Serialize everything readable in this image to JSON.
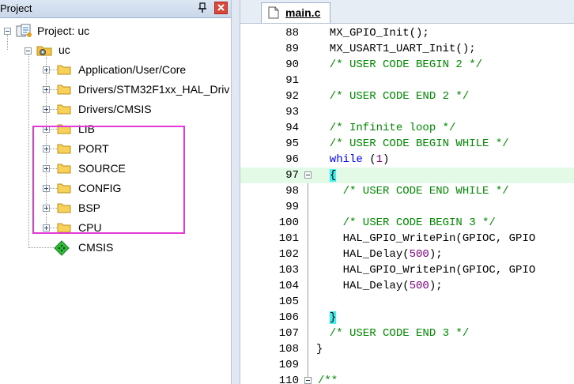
{
  "project_panel": {
    "title": "Project",
    "tree": {
      "root": "Project: uc",
      "target": "uc",
      "groups": [
        "Application/User/Core",
        "Drivers/STM32F1xx_HAL_Drive",
        "Drivers/CMSIS",
        "LIB",
        "PORT",
        "SOURCE",
        "CONFIG",
        "BSP",
        "CPU"
      ],
      "component": "CMSIS"
    },
    "highlight_color": "#e23ad7"
  },
  "editor": {
    "tab_label": "main.c",
    "lines": [
      {
        "num": "88",
        "text": "  MX_GPIO_Init();"
      },
      {
        "num": "89",
        "text": "  MX_USART1_UART_Init();"
      },
      {
        "num": "90",
        "text": "  /* USER CODE BEGIN 2 */"
      },
      {
        "num": "91",
        "text": ""
      },
      {
        "num": "92",
        "text": "  /* USER CODE END 2 */"
      },
      {
        "num": "93",
        "text": ""
      },
      {
        "num": "94",
        "text": "  /* Infinite loop */"
      },
      {
        "num": "95",
        "text": "  /* USER CODE BEGIN WHILE */"
      },
      {
        "num": "96",
        "text": "  while (1)"
      },
      {
        "num": "97",
        "text": "  {"
      },
      {
        "num": "98",
        "text": "    /* USER CODE END WHILE */"
      },
      {
        "num": "99",
        "text": ""
      },
      {
        "num": "100",
        "text": "    /* USER CODE BEGIN 3 */"
      },
      {
        "num": "101",
        "text": "    HAL_GPIO_WritePin(GPIOC, GPIO"
      },
      {
        "num": "102",
        "text": "    HAL_Delay(500);"
      },
      {
        "num": "103",
        "text": "    HAL_GPIO_WritePin(GPIOC, GPIO"
      },
      {
        "num": "104",
        "text": "    HAL_Delay(500);"
      },
      {
        "num": "105",
        "text": ""
      },
      {
        "num": "106",
        "text": "  }"
      },
      {
        "num": "107",
        "text": "  /* USER CODE END 3 */"
      },
      {
        "num": "108",
        "text": "}"
      },
      {
        "num": "109",
        "text": ""
      },
      {
        "num": "110",
        "text": "/**"
      }
    ],
    "current_line": "97",
    "colors": {
      "comment": "#008a00",
      "keyword": "#0000ff",
      "number": "#800080",
      "current_line_bg": "#e3fbe6"
    }
  }
}
